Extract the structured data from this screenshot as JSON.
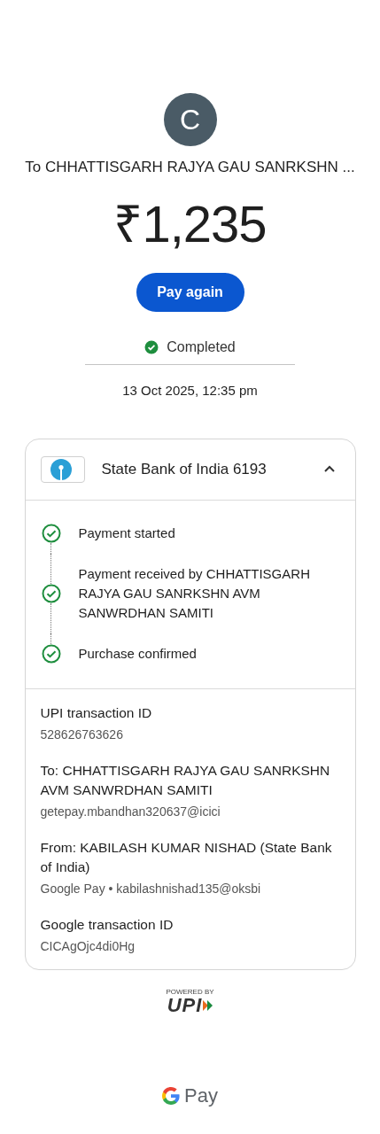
{
  "payee": {
    "initial": "C",
    "title": "To CHHATTISGARH RAJYA GAU SANRKSHN ..."
  },
  "amount": "₹1,235",
  "pay_again_button": "Pay again",
  "status": {
    "kind": "completed",
    "label": "Completed"
  },
  "date": "13 Oct 2025, 12:35 pm",
  "account_card": {
    "bank": "State Bank of India 6193",
    "expanded": true,
    "timeline": [
      {
        "label": "Payment started",
        "done": true
      },
      {
        "label": "Payment received by CHHATTISGARH RAJYA GAU SANRKSHN AVM SANWRDHAN SAMITI",
        "done": true
      },
      {
        "label": "Purchase confirmed",
        "done": true
      }
    ],
    "details": [
      {
        "label": "UPI transaction ID",
        "value": "528626763626"
      },
      {
        "label": "To: CHHATTISGARH RAJYA GAU SANRKSHN AVM SANWRDHAN SAMITI",
        "value": "getepay.mbandhan320637@icici"
      },
      {
        "label": "From: KABILASH KUMAR NISHAD (State Bank of India)",
        "value": "Google Pay • kabilashnishad135@oksbi"
      },
      {
        "label": "Google transaction ID",
        "value": "CICAgOjc4di0Hg"
      }
    ]
  },
  "footer": {
    "powered_by": "POWERED BY",
    "upi": "UPI",
    "brand": "Pay"
  }
}
